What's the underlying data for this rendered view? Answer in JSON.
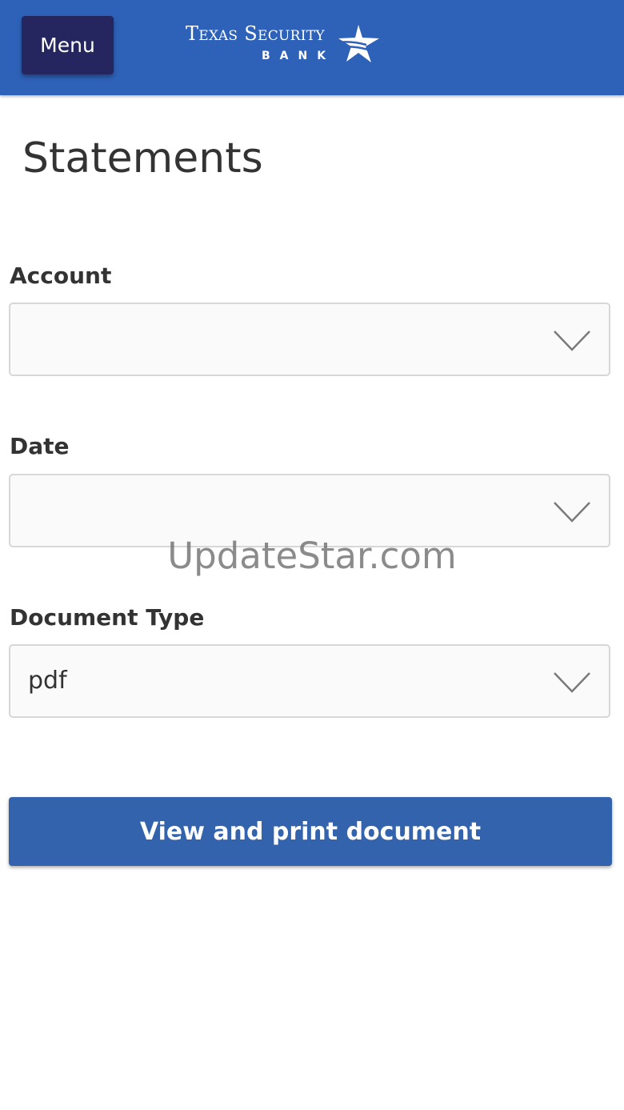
{
  "header": {
    "menu_label": "Menu",
    "logo_line1": "Texas Security",
    "logo_line2": "BANK",
    "background_color": "#2e62b8",
    "menu_button_color": "#252660"
  },
  "page": {
    "title": "Statements"
  },
  "form": {
    "account": {
      "label": "Account",
      "value": ""
    },
    "date": {
      "label": "Date",
      "value": ""
    },
    "document_type": {
      "label": "Document Type",
      "value": "pdf"
    },
    "submit_label": "View and print document",
    "submit_color": "#3463ad"
  },
  "watermark": "UpdateStar.com",
  "icons": {
    "logo_mark": "star-icon",
    "dropdown": "chevron-down-icon"
  }
}
